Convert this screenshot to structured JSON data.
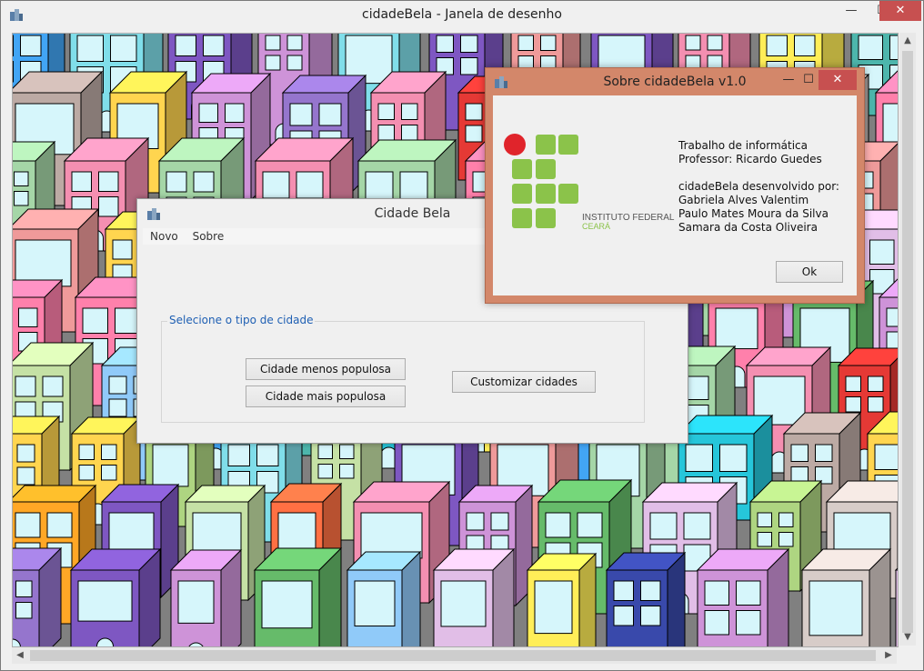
{
  "main_window": {
    "title": "cidadeBela - Janela de desenho",
    "controls": {
      "minimize": "—",
      "maximize": "☐",
      "close": "✕"
    }
  },
  "cidade_dialog": {
    "title": "Cidade Bela",
    "menu": [
      "Novo",
      "Sobre"
    ],
    "group_label": "Selecione o tipo de cidade",
    "buttons": {
      "less_populated": "Cidade menos populosa",
      "more_populated": "Cidade mais populosa",
      "customize": "Customizar cidades"
    }
  },
  "sobre_dialog": {
    "title": "Sobre cidadeBela v1.0",
    "logo_text": "INSTITUTO FEDERAL",
    "logo_subtext": "CEARÁ",
    "lines": [
      "Trabalho de informática",
      "Professor: Ricardo Guedes",
      "",
      "cidadeBela desenvolvido por:",
      "Gabriela Alves Valentim",
      "Paulo Mates Moura da Silva",
      "Samara da Costa Oliveira"
    ],
    "ok_button": "Ok",
    "controls": {
      "minimize": "—",
      "maximize": "☐",
      "close": "✕"
    }
  },
  "colors": {
    "logo_red": "#e0242b",
    "logo_green": "#8bc34a",
    "dialog_accent": "#d3876a"
  }
}
